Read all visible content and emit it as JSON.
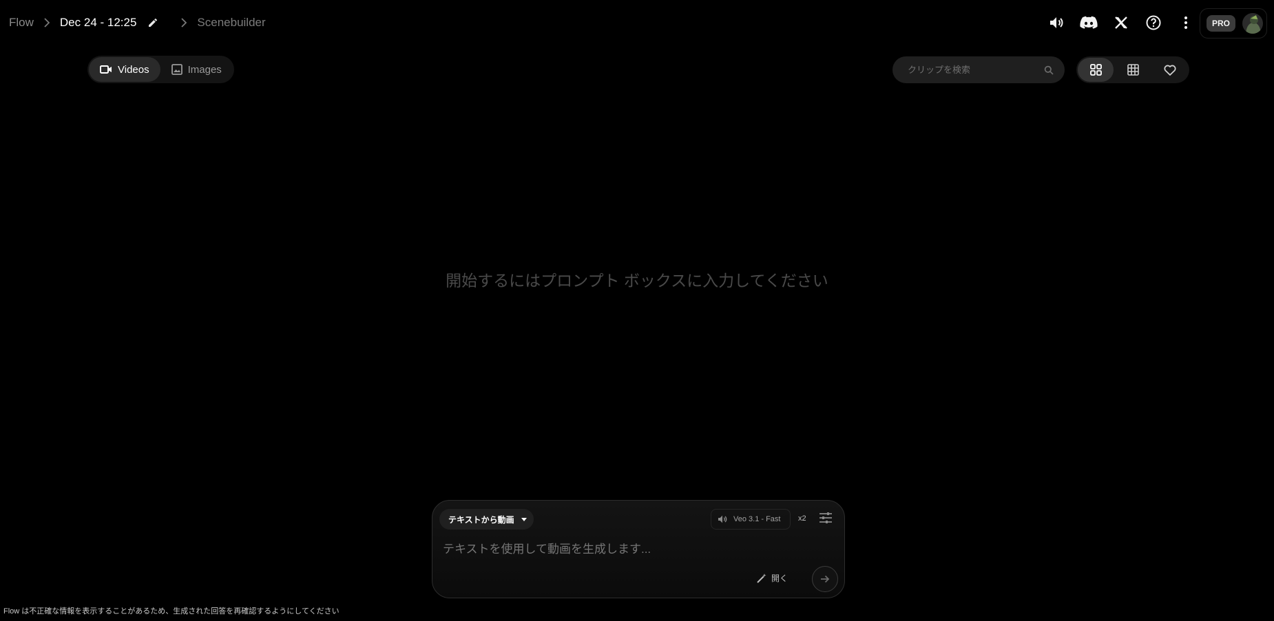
{
  "breadcrumb": {
    "root": "Flow",
    "project_title": "Dec 24 - 12:25",
    "mode": "Scenebuilder"
  },
  "header": {
    "icons": [
      "sound-icon",
      "discord-icon",
      "x-icon",
      "help-icon",
      "more-vert-icon"
    ],
    "account": {
      "badge": "PRO"
    }
  },
  "media_tabs": [
    {
      "label": "Videos",
      "icon": "video-icon",
      "active": true
    },
    {
      "label": "Images",
      "icon": "image-icon",
      "active": false
    }
  ],
  "search": {
    "placeholder": "クリップを検索",
    "value": ""
  },
  "view_toggle": {
    "options": [
      "grid-large-icon",
      "grid-small-icon",
      "heart-icon"
    ],
    "active": "grid-large-icon"
  },
  "main": {
    "empty_message": "開始するにはプロンプト ボックスに入力してください"
  },
  "composer": {
    "mode_label": "テキストから動画",
    "model_label": "Veo 3.1 - Fast",
    "count_label": "x2",
    "prompt_placeholder": "テキストを使用して動画を生成します...",
    "prompt_value": "",
    "open_label": "開く"
  },
  "footer": {
    "disclaimer": "Flow は不正確な情報を表示することがあるため、生成された回答を再確認するようにしてください"
  },
  "colors": {
    "background": "#000000",
    "surface": "#1f1f1f",
    "active_tab": "#2a2a2a",
    "muted_text": "#8a8a8a"
  }
}
